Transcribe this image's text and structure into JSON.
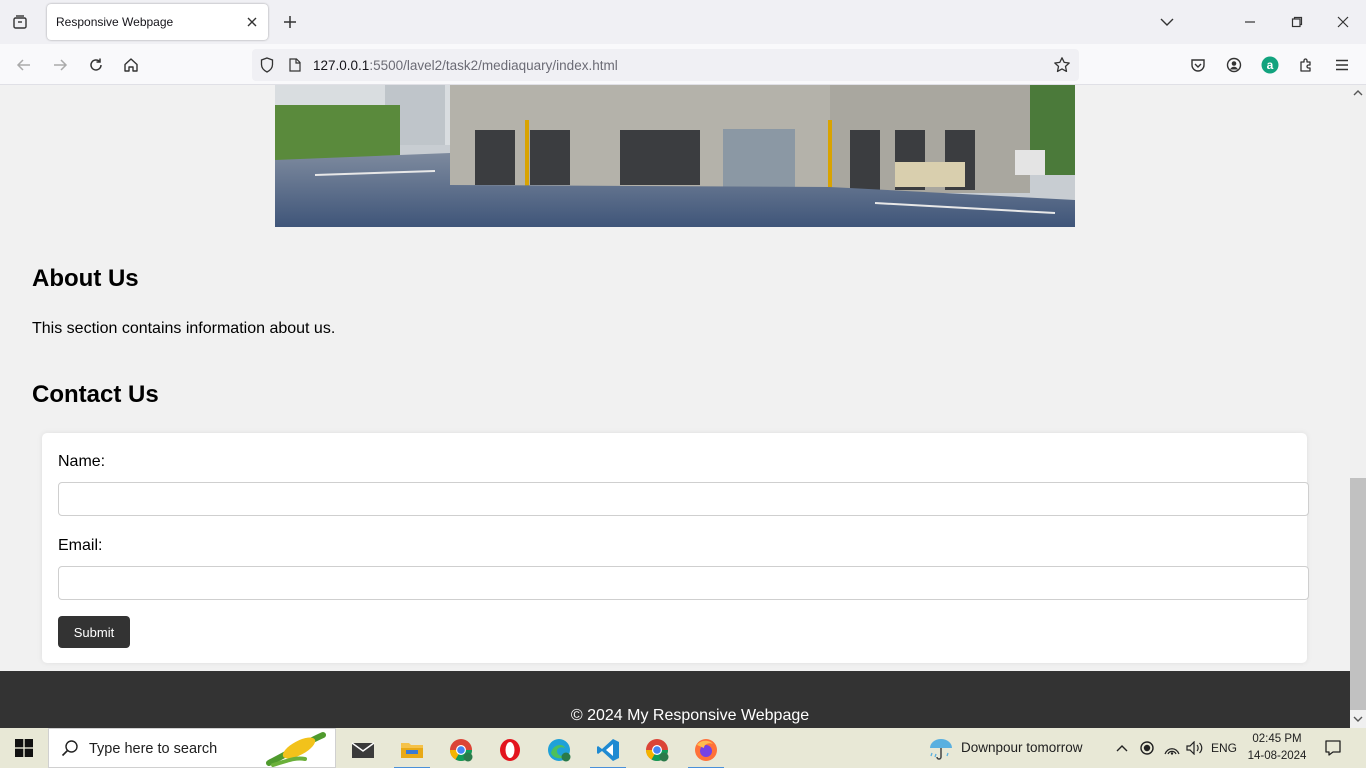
{
  "browser": {
    "tab_title": "Responsive Webpage",
    "url_host": "127.0.0.1",
    "url_path": ":5500/lavel2/task2/mediaquary/index.html"
  },
  "page": {
    "about_heading": "About Us",
    "about_text": "This section contains information about us.",
    "contact_heading": "Contact Us",
    "form": {
      "name_label": "Name:",
      "name_value": "",
      "email_label": "Email:",
      "email_value": "",
      "submit_label": "Submit"
    },
    "footer_text": "© 2024 My Responsive Webpage"
  },
  "taskbar": {
    "search_placeholder": "Type here to search",
    "weather": "Downpour tomorrow",
    "language": "ENG",
    "time": "02:45 PM",
    "date": "14-08-2024"
  },
  "colors": {
    "footer_bg": "#333333",
    "page_bg": "#f1f1f1",
    "button_bg": "#333333"
  }
}
